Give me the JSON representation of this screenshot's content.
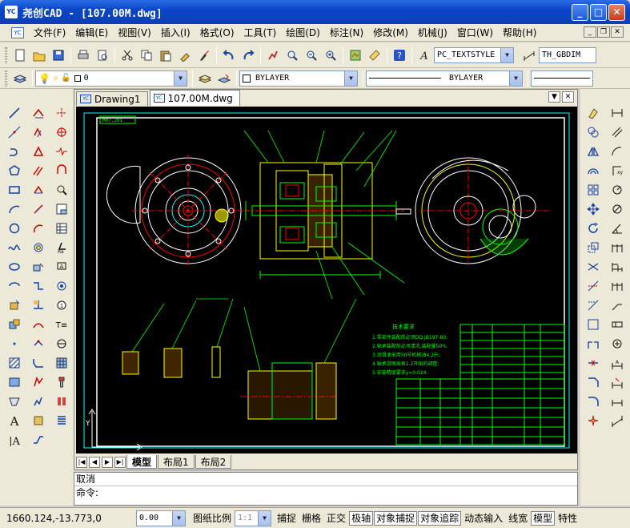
{
  "app": {
    "title": "尧创CAD - [107.00M.dwg]",
    "icon_label": "YC"
  },
  "menu": {
    "items": [
      "文件(F)",
      "编辑(E)",
      "视图(V)",
      "插入(I)",
      "格式(O)",
      "工具(T)",
      "绘图(D)",
      "标注(N)",
      "修改(M)",
      "机械(J)",
      "窗口(W)",
      "帮助(H)"
    ]
  },
  "toolbar": {
    "textstyle": "PC_TEXTSTYLE",
    "dimstyle": "TH_GBDIM",
    "layer": "0",
    "color": "BYLAYER",
    "linetype": "BYLAYER"
  },
  "tabs": {
    "doc1": "Drawing1",
    "doc2": "107.00M.dwg"
  },
  "drawing": {
    "frame_label": "M07.201",
    "notes_title": "技术要求",
    "notes": [
      "1.零部件装配前必须DQ.JB197-80;",
      "2.轴承装配前必须清洗,装配量50%",
      "3.润滑油采用50号机械油4.2升;",
      "4.轴承游隙按表1.2开始的调整;",
      "5.安装精度要求y=0.024."
    ]
  },
  "layout_tabs": [
    "模型",
    "布局1",
    "布局2"
  ],
  "command": {
    "history": "取消",
    "prompt": "命令:"
  },
  "status": {
    "coords": "1660.124,-13.773,0",
    "lineweight_value": "0.00",
    "scale_label": "图纸比例",
    "scale_value": "1:1",
    "toggles": [
      "捕捉",
      "栅格",
      "正交",
      "极轴",
      "对象捕捉",
      "对象追踪",
      "动态输入",
      "线宽",
      "模型",
      "特性"
    ]
  },
  "colors": {
    "titlebar": "#0a46c8",
    "canvas_bg": "#000000",
    "cad_green": "#00ff00",
    "cad_yellow": "#ffff00",
    "cad_red": "#ff0000",
    "cad_cyan": "#00ffff"
  }
}
